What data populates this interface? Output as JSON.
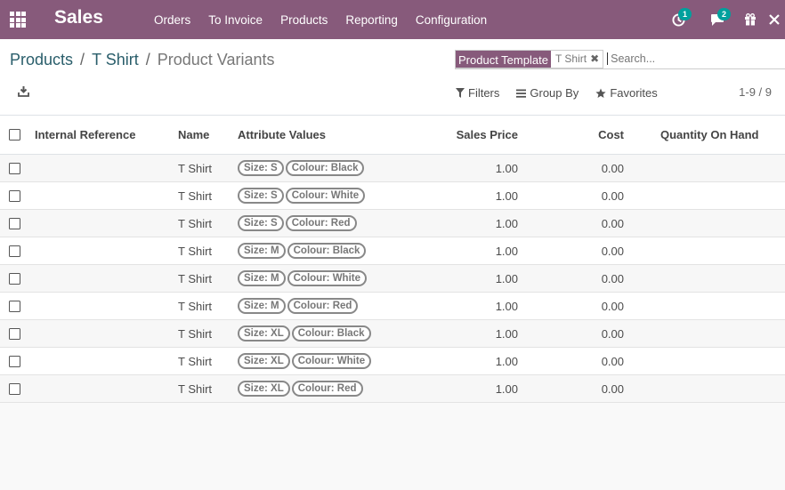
{
  "app": {
    "title": "Sales"
  },
  "menu": [
    "Orders",
    "To Invoice",
    "Products",
    "Reporting",
    "Configuration"
  ],
  "systray": {
    "activity_count": "1",
    "messages_count": "2"
  },
  "breadcrumb": {
    "root": "Products",
    "parent": "T Shirt",
    "current": "Product Variants"
  },
  "search": {
    "facet_label": "Product Template",
    "facet_value": "T Shirt",
    "placeholder": "Search..."
  },
  "filters": {
    "filters": "Filters",
    "group_by": "Group By",
    "favorites": "Favorites"
  },
  "pager": "1-9 / 9",
  "columns": {
    "ref": "Internal Reference",
    "name": "Name",
    "attrs": "Attribute Values",
    "price": "Sales Price",
    "cost": "Cost",
    "qty": "Quantity On Hand"
  },
  "rows": [
    {
      "name": "T Shirt",
      "size": "Size: S",
      "colour": "Colour: Black",
      "price": "1.00",
      "cost": "0.00"
    },
    {
      "name": "T Shirt",
      "size": "Size: S",
      "colour": "Colour: White",
      "price": "1.00",
      "cost": "0.00"
    },
    {
      "name": "T Shirt",
      "size": "Size: S",
      "colour": "Colour: Red",
      "price": "1.00",
      "cost": "0.00"
    },
    {
      "name": "T Shirt",
      "size": "Size: M",
      "colour": "Colour: Black",
      "price": "1.00",
      "cost": "0.00"
    },
    {
      "name": "T Shirt",
      "size": "Size: M",
      "colour": "Colour: White",
      "price": "1.00",
      "cost": "0.00"
    },
    {
      "name": "T Shirt",
      "size": "Size: M",
      "colour": "Colour: Red",
      "price": "1.00",
      "cost": "0.00"
    },
    {
      "name": "T Shirt",
      "size": "Size: XL",
      "colour": "Colour: Black",
      "price": "1.00",
      "cost": "0.00"
    },
    {
      "name": "T Shirt",
      "size": "Size: XL",
      "colour": "Colour: White",
      "price": "1.00",
      "cost": "0.00"
    },
    {
      "name": "T Shirt",
      "size": "Size: XL",
      "colour": "Colour: Red",
      "price": "1.00",
      "cost": "0.00"
    }
  ],
  "colors": {
    "brand": "#875a7b",
    "badge": "#00a09d",
    "link": "#2a5e6b"
  }
}
